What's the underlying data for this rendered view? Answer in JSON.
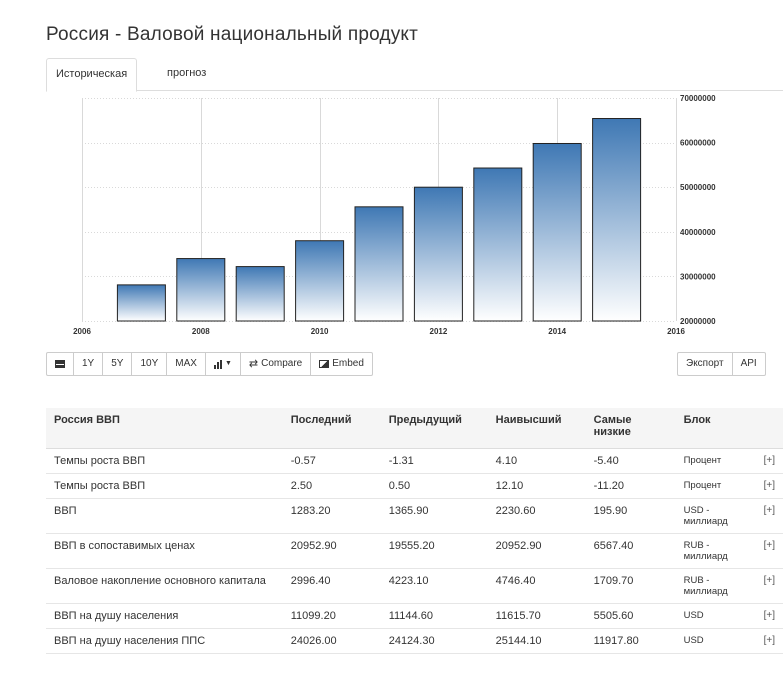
{
  "page": {
    "title": "Россия - Валовой национальный продукт"
  },
  "tabs": [
    {
      "label": "Историческая",
      "active": true
    },
    {
      "label": "прогноз",
      "active": false
    }
  ],
  "chart_data": {
    "type": "bar",
    "x": [
      2007,
      2008,
      2009,
      2010,
      2011,
      2012,
      2013,
      2014,
      2015
    ],
    "values": [
      28100000,
      34000000,
      32200000,
      38000000,
      45600000,
      50000000,
      54300000,
      59800000,
      65400000
    ],
    "x_ticks": [
      "2006",
      "2008",
      "2010",
      "2012",
      "2014",
      "2016"
    ],
    "xlim": [
      2006,
      2016
    ],
    "y_ticks": [
      "20000000",
      "30000000",
      "40000000",
      "50000000",
      "60000000",
      "70000000"
    ],
    "ylim": [
      20000000,
      70000000
    ],
    "y_axis_side": "right",
    "grid": true,
    "bar_color_top": "#3f78b4",
    "bar_color_bottom": "#ffffff"
  },
  "toolbar": {
    "left": [
      "1Y",
      "5Y",
      "10Y",
      "MAX"
    ],
    "compare": "Compare",
    "embed": "Embed",
    "export": "Экспорт",
    "api": "API"
  },
  "table": {
    "headers": [
      "Россия ВВП",
      "Последний",
      "Предыдущий",
      "Наивысший",
      "Самые низкие",
      "Блок",
      ""
    ],
    "rows": [
      [
        "Темпы роста ВВП",
        "-0.57",
        "-1.31",
        "4.10",
        "-5.40",
        "Процент",
        "[+]"
      ],
      [
        "Темпы роста ВВП",
        "2.50",
        "0.50",
        "12.10",
        "-11.20",
        "Процент",
        "[+]"
      ],
      [
        "ВВП",
        "1283.20",
        "1365.90",
        "2230.60",
        "195.90",
        "USD - миллиард",
        "[+]"
      ],
      [
        "ВВП в сопоставимых ценах",
        "20952.90",
        "19555.20",
        "20952.90",
        "6567.40",
        "RUB - миллиард",
        "[+]"
      ],
      [
        "Валовое накопление основного капитала",
        "2996.40",
        "4223.10",
        "4746.40",
        "1709.70",
        "RUB - миллиард",
        "[+]"
      ],
      [
        "ВВП на душу населения",
        "11099.20",
        "11144.60",
        "11615.70",
        "5505.60",
        "USD",
        "[+]"
      ],
      [
        "ВВП на душу населения ППС",
        "24026.00",
        "24124.30",
        "25144.10",
        "11917.80",
        "USD",
        "[+]"
      ]
    ]
  }
}
